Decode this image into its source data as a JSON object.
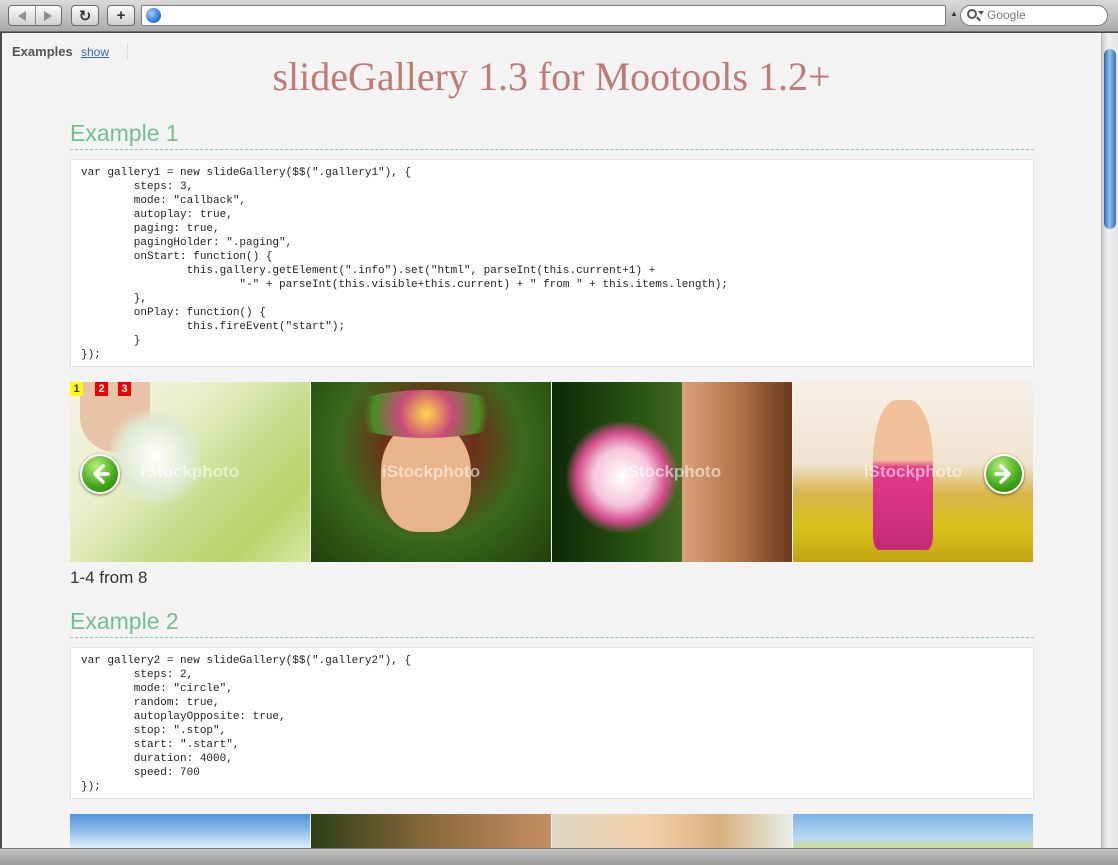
{
  "browser": {
    "back_icon": "back-arrow-icon",
    "forward_icon": "forward-arrow-icon",
    "reload_glyph": "↻",
    "new_tab_glyph": "+",
    "url": "",
    "search_placeholder": "Google"
  },
  "page": {
    "examples_label": "Examples",
    "show_link": "show",
    "title": "slideGallery 1.3 for Mootools 1.2+",
    "example1": {
      "heading": "Example 1",
      "code": [
        "var gallery1 = new slideGallery($$(\".gallery1\"), {",
        "        steps: 3,",
        "        mode: \"callback\",",
        "        autoplay: true,",
        "        paging: true,",
        "        pagingHolder: \".paging\",",
        "        onStart: function() {",
        "                this.gallery.getElement(\".info\").set(\"html\", parseInt(this.current+1) +",
        "                        \"-\" + parseInt(this.visible+this.current) + \" from \" + this.items.length);",
        "        },",
        "        onPlay: function() {",
        "                this.fireEvent(\"start\");",
        "        }",
        "});"
      ],
      "paging": [
        "1",
        "2",
        "3"
      ],
      "watermark": "iStockphoto",
      "info": "1-4 from 8"
    },
    "example2": {
      "heading": "Example 2",
      "code": [
        "var gallery2 = new slideGallery($$(\".gallery2\"), {",
        "        steps: 2,",
        "        mode: \"circle\",",
        "        random: true,",
        "        autoplayOpposite: true,",
        "        stop: \".stop\",",
        "        start: \".start\",",
        "        duration: 4000,",
        "        speed: 700",
        "});"
      ]
    }
  },
  "colors": {
    "title": "#c07a77",
    "heading": "#74bf92",
    "link": "#3366cc"
  }
}
